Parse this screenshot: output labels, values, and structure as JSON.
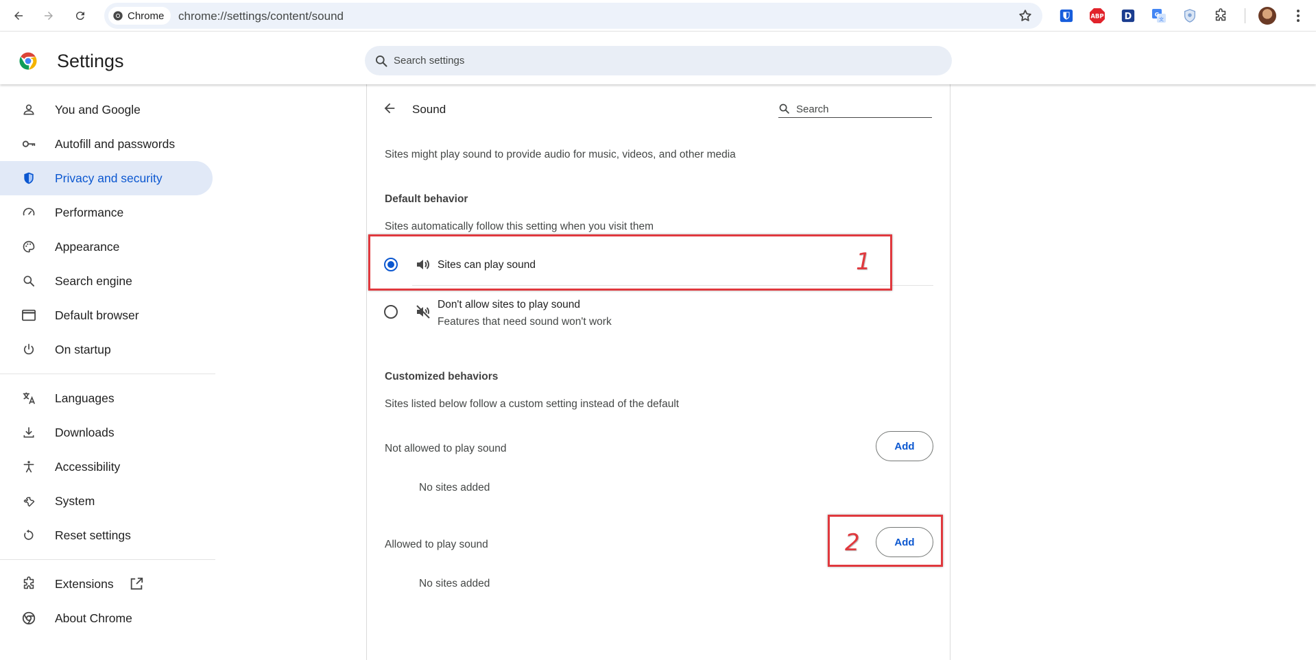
{
  "browser": {
    "chip_label": "Chrome",
    "url": "chrome://settings/content/sound",
    "extensions": [
      {
        "name": "bitwarden-icon",
        "color": "#175ddc"
      },
      {
        "name": "adblock-plus-icon",
        "color": "#e1232b",
        "label": "ABP"
      },
      {
        "name": "dashlane-icon",
        "color": "#1b3d8f",
        "label": "D"
      },
      {
        "name": "google-translate-icon",
        "color": "#4285f4"
      },
      {
        "name": "privacy-badger-icon",
        "color": "#7fa2d4"
      },
      {
        "name": "extensions-puzzle-icon",
        "color": "#474747"
      }
    ]
  },
  "header": {
    "title": "Settings",
    "search_placeholder": "Search settings"
  },
  "sidebar": {
    "active": "Privacy and security",
    "items": [
      {
        "label": "You and Google",
        "icon": "person-icon"
      },
      {
        "label": "Autofill and passwords",
        "icon": "key-icon"
      },
      {
        "label": "Privacy and security",
        "icon": "shield-icon"
      },
      {
        "label": "Performance",
        "icon": "speedometer-icon"
      },
      {
        "label": "Appearance",
        "icon": "palette-icon"
      },
      {
        "label": "Search engine",
        "icon": "search-icon"
      },
      {
        "label": "Default browser",
        "icon": "browser-window-icon"
      },
      {
        "label": "On startup",
        "icon": "power-icon"
      },
      {
        "label": "Languages",
        "icon": "translate-icon"
      },
      {
        "label": "Downloads",
        "icon": "download-icon"
      },
      {
        "label": "Accessibility",
        "icon": "accessibility-icon"
      },
      {
        "label": "System",
        "icon": "wrench-icon"
      },
      {
        "label": "Reset settings",
        "icon": "reset-icon"
      },
      {
        "label": "Extensions",
        "icon": "puzzle-icon"
      },
      {
        "label": "About Chrome",
        "icon": "chrome-icon"
      }
    ]
  },
  "main": {
    "title": "Sound",
    "search_placeholder": "Search",
    "description": "Sites might play sound to provide audio for music, videos, and other media",
    "default_behavior": {
      "heading": "Default behavior",
      "subtext": "Sites automatically follow this setting when you visit them",
      "options": [
        {
          "label": "Sites can play sound",
          "sublabel": "",
          "selected": true,
          "icon": "volume-icon"
        },
        {
          "label": "Don't allow sites to play sound",
          "sublabel": "Features that need sound won't work",
          "selected": false,
          "icon": "volume-off-icon"
        }
      ]
    },
    "customized": {
      "heading": "Customized behaviors",
      "subtext": "Sites listed below follow a custom setting instead of the default",
      "lists": [
        {
          "label": "Not allowed to play sound",
          "button": "Add",
          "empty": "No sites added"
        },
        {
          "label": "Allowed to play sound",
          "button": "Add",
          "empty": "No sites added"
        }
      ]
    }
  },
  "annotations": [
    {
      "number": "1",
      "color": "#e0393e"
    },
    {
      "number": "2",
      "color": "#e0393e"
    }
  ]
}
